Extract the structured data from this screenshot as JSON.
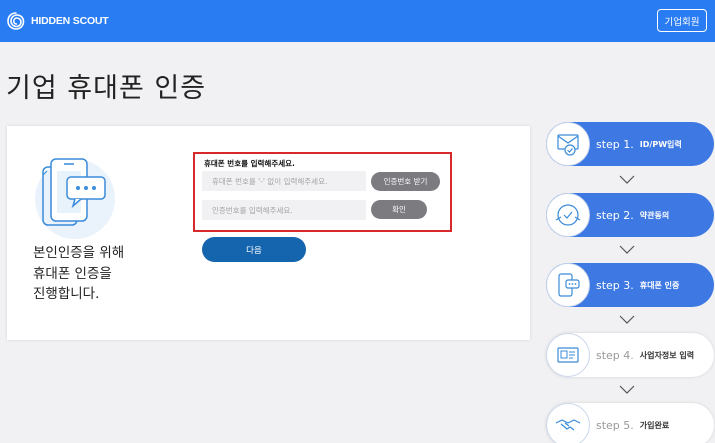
{
  "header": {
    "logo_text": "HIDDEN SCOUT",
    "member_button": "기업회원"
  },
  "page": {
    "title": "기업 휴대폰 인증"
  },
  "main": {
    "intro_lines": [
      "본인인증을 위해",
      "휴대폰 인증을",
      "진행합니다."
    ],
    "form": {
      "label": "휴대폰 번호를 입력해주세요.",
      "phone_placeholder": "휴대폰 번호를 '-' 없이 입력해주세요.",
      "send_code_button": "인증번호 받기",
      "code_placeholder": "인증번호를 입력해주세요.",
      "confirm_button": "확인"
    },
    "next_button": "다음"
  },
  "steps": [
    {
      "num": "step 1.",
      "name": "ID/PW입력",
      "active": true,
      "icon": "mail-check-icon"
    },
    {
      "num": "step 2.",
      "name": "약관동의",
      "active": true,
      "icon": "agreement-icon"
    },
    {
      "num": "step 3.",
      "name": "휴대폰 인증",
      "active": true,
      "icon": "phone-chat-icon"
    },
    {
      "num": "step 4.",
      "name": "사업자정보 입력",
      "active": false,
      "icon": "business-id-icon"
    },
    {
      "num": "step 5.",
      "name": "가입완료",
      "active": false,
      "icon": "handshake-icon"
    }
  ],
  "colors": {
    "header_bg": "#2a7cf3",
    "step_active": "#3d78e3",
    "next_button": "#1465ad",
    "highlight_border": "#d7282c",
    "gray_button": "#7b7b80"
  }
}
